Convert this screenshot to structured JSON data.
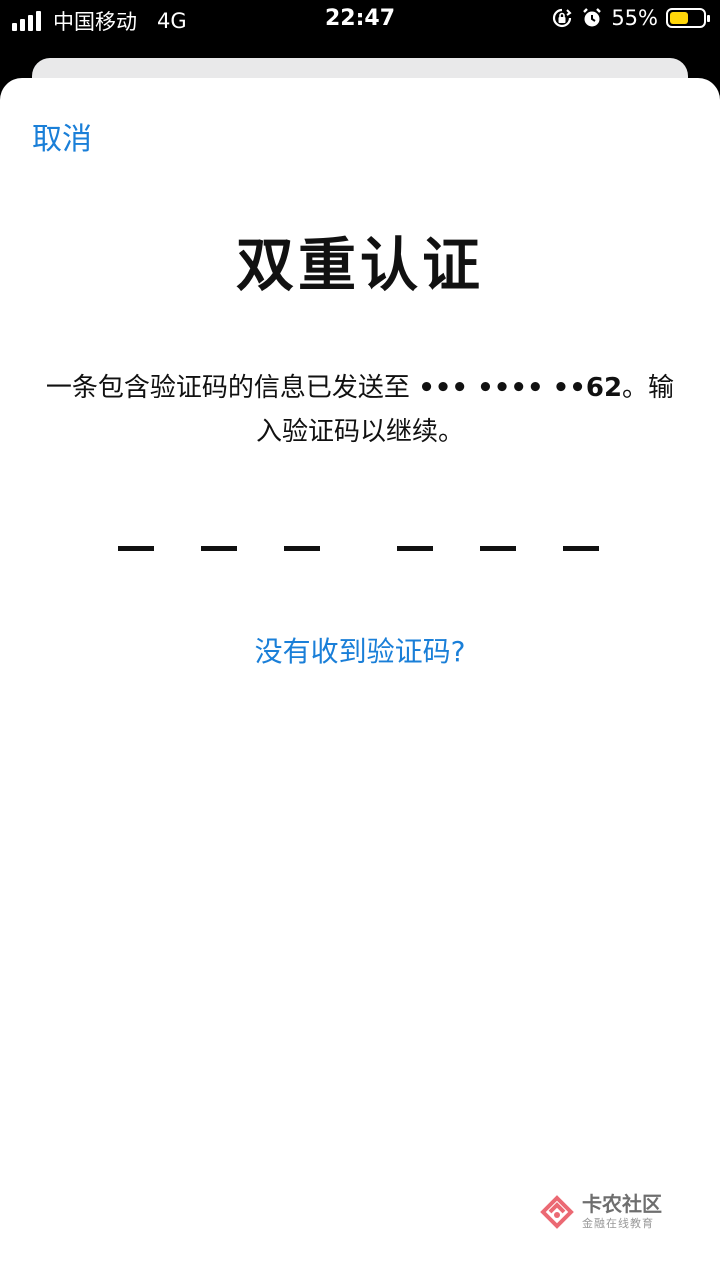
{
  "status_bar": {
    "carrier": "中国移动",
    "network": "4G",
    "time": "22:47",
    "battery_percent": "55%",
    "battery_level": 0.55,
    "icons": [
      "signal-icon",
      "rotation-lock-icon",
      "alarm-icon",
      "battery-icon"
    ]
  },
  "header": {
    "cancel_label": "取消"
  },
  "main": {
    "title": "双重认证",
    "message_prefix": "一条包含验证码的信息已发送至 ",
    "masked_number": "••• •••• ••62",
    "message_suffix": "。输入验证码以继续。",
    "code_digits": [
      "",
      "",
      "",
      "",
      "",
      ""
    ],
    "resend_link": "没有收到验证码?"
  },
  "watermark": {
    "name": "卡农社区",
    "tagline": "金融在线教育"
  },
  "colors": {
    "accent": "#1a7fd8",
    "battery_fill": "#ffd60a"
  }
}
